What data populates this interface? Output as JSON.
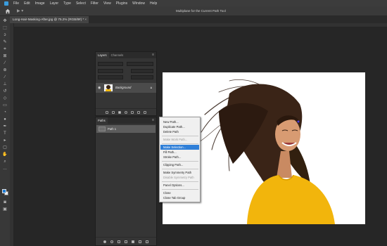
{
  "menubar": {
    "items": [
      "File",
      "Edit",
      "Image",
      "Layer",
      "Type",
      "Select",
      "Filter",
      "View",
      "Plugins",
      "Window",
      "Help"
    ]
  },
  "optionsbar": {
    "hint": "Multiplane for the Current Path Tool"
  },
  "document_tab": {
    "title": "Long-Hair-Masking-After.jpg @ 75.2% (RGB/8#) *",
    "close": "×"
  },
  "layers_panel": {
    "tabs": [
      "Layers",
      "Channels"
    ],
    "menu": "≡",
    "layer": {
      "name": "Background",
      "visible": true
    }
  },
  "paths_panel": {
    "title": "Paths",
    "menu": "≡",
    "path": {
      "name": "Path 1"
    }
  },
  "context_menu": {
    "items": [
      {
        "label": "New Path...",
        "state": "normal"
      },
      {
        "label": "Duplicate Path...",
        "state": "normal"
      },
      {
        "label": "Delete Path",
        "state": "normal"
      },
      {
        "label": "Make Work Path...",
        "state": "disabled"
      },
      {
        "label": "Make Selection...",
        "state": "highlighted"
      },
      {
        "label": "Fill Path...",
        "state": "normal"
      },
      {
        "label": "Stroke Path...",
        "state": "normal"
      },
      {
        "label": "Clipping Path...",
        "state": "normal"
      },
      {
        "label": "Make Symmetry Path",
        "state": "normal"
      },
      {
        "label": "Disable Symmetry Path",
        "state": "disabled"
      },
      {
        "label": "Panel Options...",
        "state": "normal"
      },
      {
        "label": "Close",
        "state": "normal"
      },
      {
        "label": "Close Tab Group",
        "state": "normal"
      }
    ]
  },
  "colors": {
    "foreground": "#1f7dd6",
    "background": "#f0f0f0",
    "highlight": "#2f7fd8"
  },
  "icons": {
    "home": "home-icon",
    "visibility": "eye-icon",
    "lock": "lock-icon"
  }
}
